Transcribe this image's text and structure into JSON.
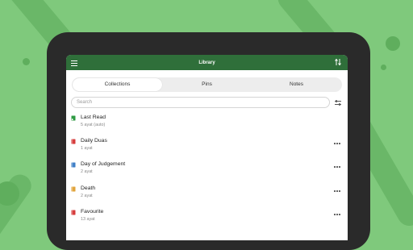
{
  "appbar": {
    "title": "Library",
    "menu_icon": "hamburger-menu-icon",
    "sort_icon": "sort-arrows-icon"
  },
  "tabs": [
    {
      "label": "Collections",
      "active": true
    },
    {
      "label": "Pins",
      "active": false
    },
    {
      "label": "Notes",
      "active": false
    }
  ],
  "search": {
    "placeholder": "Search",
    "filter_icon": "filter-sliders-icon"
  },
  "collections": [
    {
      "name": "Last Read",
      "sub": "5 ayat (auto)",
      "icon": "last-read-book-icon",
      "color": "#2e9a43",
      "more": false
    },
    {
      "name": "Daily Duas",
      "sub": "1 ayat",
      "icon": "book-icon",
      "color": "#d63b3b",
      "more": true
    },
    {
      "name": "Day of Judgement",
      "sub": "2 ayat",
      "icon": "book-icon",
      "color": "#3f7fc7",
      "more": true
    },
    {
      "name": "Death",
      "sub": "2 ayat",
      "icon": "book-icon",
      "color": "#e0a33a",
      "more": true
    },
    {
      "name": "Favourite",
      "sub": "13 ayat",
      "icon": "book-icon",
      "color": "#d63b3b",
      "more": true
    }
  ],
  "colors": {
    "background": "#7fc97c",
    "appbar": "#2f6f3a",
    "tablet": "#2a2a2a"
  }
}
